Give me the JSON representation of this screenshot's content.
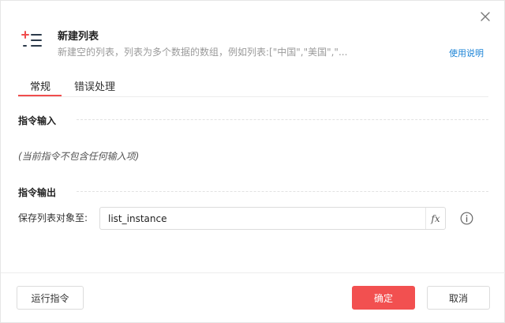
{
  "header": {
    "title": "新建列表",
    "description": "新建空的列表，列表为多个数据的数组，例如列表:[\"中国\",\"美国\",\"...",
    "help_link": "使用说明",
    "icon": "list-add-icon",
    "close_icon": "close-icon"
  },
  "tabs": [
    {
      "label": "常规",
      "active": true
    },
    {
      "label": "错误处理",
      "active": false
    }
  ],
  "sections": {
    "input": {
      "title": "指令输入",
      "empty_note": "(当前指令不包含任何输入项)"
    },
    "output": {
      "title": "指令输出",
      "field_label": "保存列表对象至:",
      "field_value": "list_instance",
      "fx_label": "fx",
      "info_icon": "info-icon"
    }
  },
  "footer": {
    "run_label": "运行指令",
    "ok_label": "确定",
    "cancel_label": "取消"
  },
  "colors": {
    "accent": "#f25050",
    "link": "#1a83d6",
    "icon_red": "#f04d4d",
    "icon_dark": "#2b3a4a"
  }
}
